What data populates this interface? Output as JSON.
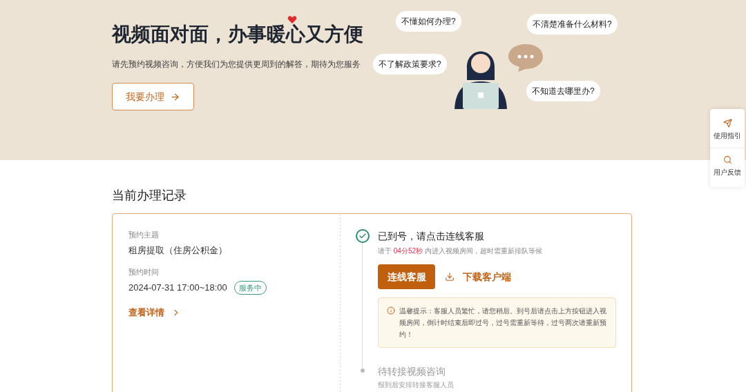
{
  "hero": {
    "title": "视频面对面，办事暖心又方便",
    "subtitle": "请先预约视频咨询，方便我们为您提供更周到的解答，期待为您服务",
    "button": "我要办理",
    "bubbles": [
      "不懂如何办理?",
      "不清楚准备什么材料?",
      "不了解政策要求?",
      "不知道去哪里办?"
    ]
  },
  "side_panel": {
    "items": [
      "使用指引",
      "用户反馈"
    ]
  },
  "record": {
    "heading": "当前办理记录",
    "topic_label": "预约主题",
    "topic": "租房提取（住房公积金）",
    "time_label": "预约时间",
    "time": "2024-07-31 17:00~18:00",
    "status": "服务中",
    "details_link": "查看详情",
    "steps": [
      {
        "kind": "done",
        "title": "已到号，请点击连线客服",
        "hint_before": "请于",
        "countdown": "04分52秒",
        "hint_after": "内进入视频房间，超时需重新排队等候",
        "primary_button": "连线客服",
        "download_link": "下载客户端",
        "notice": "温馨提示：客服人员繁忙，请您稍后。到号后请点击上方按钮进入视频房间，倒计时结束后即过号，过号需重新等待，过号两次请重新预约！"
      },
      {
        "kind": "pending",
        "title": "待转接视频咨询",
        "subtitle": "报到后安排转接客服人员"
      }
    ]
  }
}
